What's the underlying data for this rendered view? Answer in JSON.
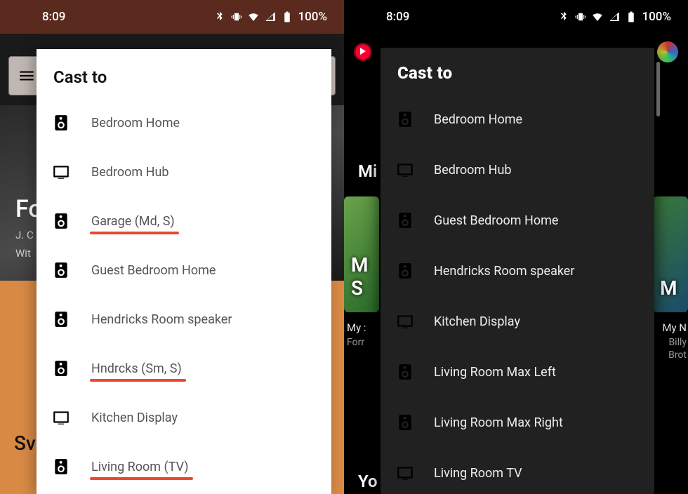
{
  "status": {
    "time": "8:09",
    "battery": "100%"
  },
  "left": {
    "hero_title": "Fo",
    "hero_artist": "J. C",
    "hero_sub": "Wit",
    "lower_title": "Sv",
    "cast": {
      "title": "Cast to",
      "items": [
        {
          "label": "Bedroom Home",
          "icon": "speaker",
          "underline": false
        },
        {
          "label": "Bedroom Hub",
          "icon": "tv",
          "underline": false
        },
        {
          "label": "Garage (Md, S)",
          "icon": "speaker",
          "underline": true
        },
        {
          "label": "Guest Bedroom Home",
          "icon": "speaker",
          "underline": false
        },
        {
          "label": "Hendricks Room speaker",
          "icon": "speaker",
          "underline": false
        },
        {
          "label": "Hndrcks (Sm, S)",
          "icon": "speaker",
          "underline": true
        },
        {
          "label": "Kitchen Display",
          "icon": "tv",
          "underline": false
        },
        {
          "label": "Living Room (TV)",
          "icon": "speaker",
          "underline": true
        }
      ]
    }
  },
  "right": {
    "section1": "Mi",
    "section2": "Yo",
    "tile_left_title": "M",
    "tile_left_sub1": "S",
    "tile_left_cap": "My :",
    "tile_left_cap2": "Forr",
    "tile_right_title": "M",
    "tile_right_cap": "My N",
    "tile_right_cap2": "Billy",
    "tile_right_cap3": "Brot",
    "cast": {
      "title": "Cast to",
      "items": [
        {
          "label": "Bedroom Home",
          "icon": "speaker"
        },
        {
          "label": "Bedroom Hub",
          "icon": "tv"
        },
        {
          "label": "Guest Bedroom Home",
          "icon": "speaker"
        },
        {
          "label": "Hendricks Room speaker",
          "icon": "speaker"
        },
        {
          "label": "Kitchen Display",
          "icon": "tv"
        },
        {
          "label": "Living Room Max Left",
          "icon": "speaker"
        },
        {
          "label": "Living Room Max Right",
          "icon": "speaker"
        },
        {
          "label": "Living Room TV",
          "icon": "tv"
        }
      ]
    }
  }
}
